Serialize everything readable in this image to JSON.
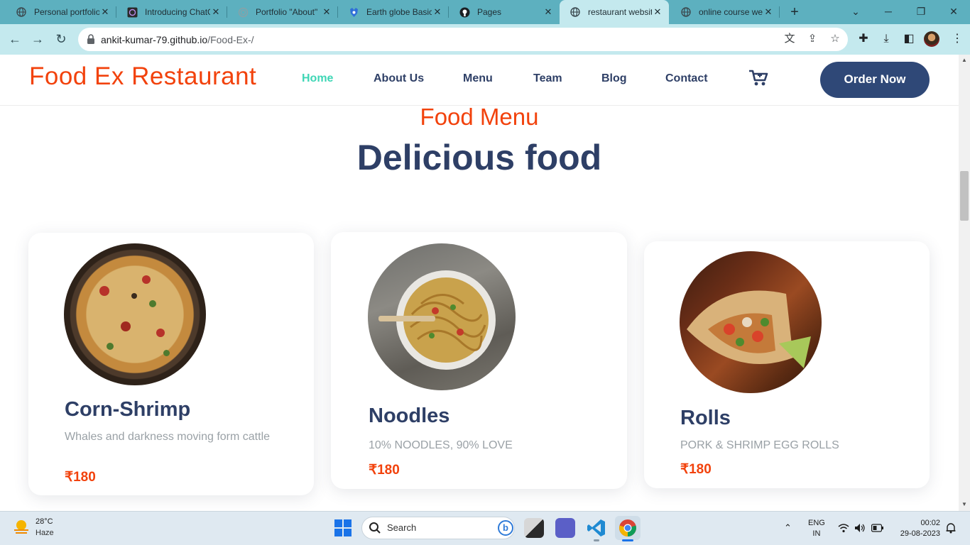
{
  "browser": {
    "tabs": [
      {
        "title": "Personal portfolio",
        "icon": "globe-icon"
      },
      {
        "title": "Introducing ChatGPT",
        "icon": "openai-icon"
      },
      {
        "title": "Portfolio \"About\"",
        "icon": "openai-icon"
      },
      {
        "title": "Earth globe Basic",
        "icon": "codepen-icon"
      },
      {
        "title": "Pages",
        "icon": "github-icon"
      },
      {
        "title": "restaurant website",
        "icon": "globe-icon",
        "active": true
      },
      {
        "title": "online course web",
        "icon": "globe-icon"
      }
    ],
    "url_host": "ankit-kumar-79.github.io",
    "url_path": "/Food-Ex-/"
  },
  "site": {
    "logo": "Food Ex Restaurant",
    "nav": [
      "Home",
      "About Us",
      "Menu",
      "Team",
      "Blog",
      "Contact"
    ],
    "active_nav": "Home",
    "order_button": "Order Now",
    "colors": {
      "accent": "#f2420c",
      "navy": "#2e3f66",
      "active": "#3ed6b5",
      "button": "#2f4877"
    }
  },
  "menu": {
    "kicker": "Food Menu",
    "heading": "Delicious food",
    "items": [
      {
        "name": "Corn-Shrimp",
        "description": "Whales and darkness moving form cattle",
        "price": "₹180"
      },
      {
        "name": "Noodles",
        "description": "10% NOODLES, 90% LOVE",
        "price": "₹180"
      },
      {
        "name": "Rolls",
        "description": "PORK & SHRIMP EGG ROLLS",
        "price": "₹180"
      }
    ]
  },
  "taskbar": {
    "weather_temp": "28°C",
    "weather_condition": "Haze",
    "search_placeholder": "Search",
    "lang_primary": "ENG",
    "lang_secondary": "IN",
    "time": "00:02",
    "date": "29-08-2023"
  }
}
